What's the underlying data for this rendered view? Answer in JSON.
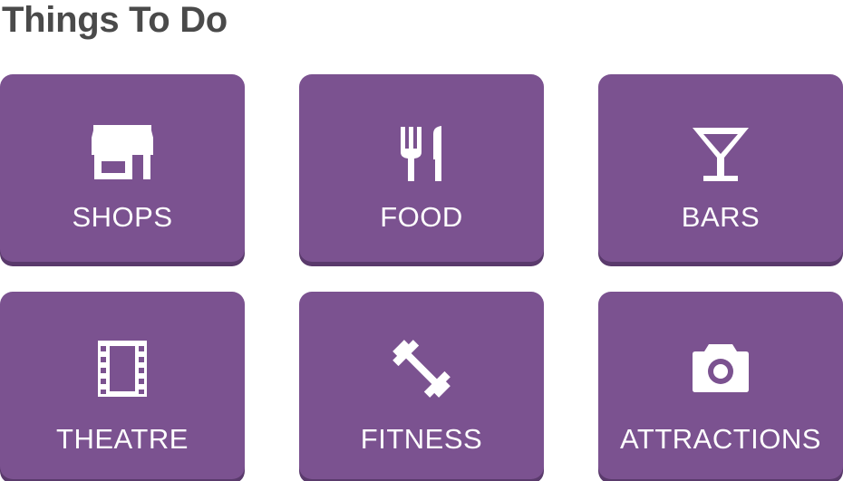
{
  "title": "Things To Do",
  "colors": {
    "tile_background": "#7b5290",
    "tile_shadow": "#5a3a6c",
    "title_text": "#4a4a4a",
    "tile_text": "#ffffff"
  },
  "tiles": [
    {
      "label": "SHOPS",
      "icon": "storefront-icon"
    },
    {
      "label": "FOOD",
      "icon": "fork-knife-icon"
    },
    {
      "label": "BARS",
      "icon": "cocktail-glass-icon"
    },
    {
      "label": "THEATRE",
      "icon": "film-strip-icon"
    },
    {
      "label": "FITNESS",
      "icon": "dumbbell-icon"
    },
    {
      "label": "ATTRACTIONS",
      "icon": "camera-icon"
    }
  ]
}
